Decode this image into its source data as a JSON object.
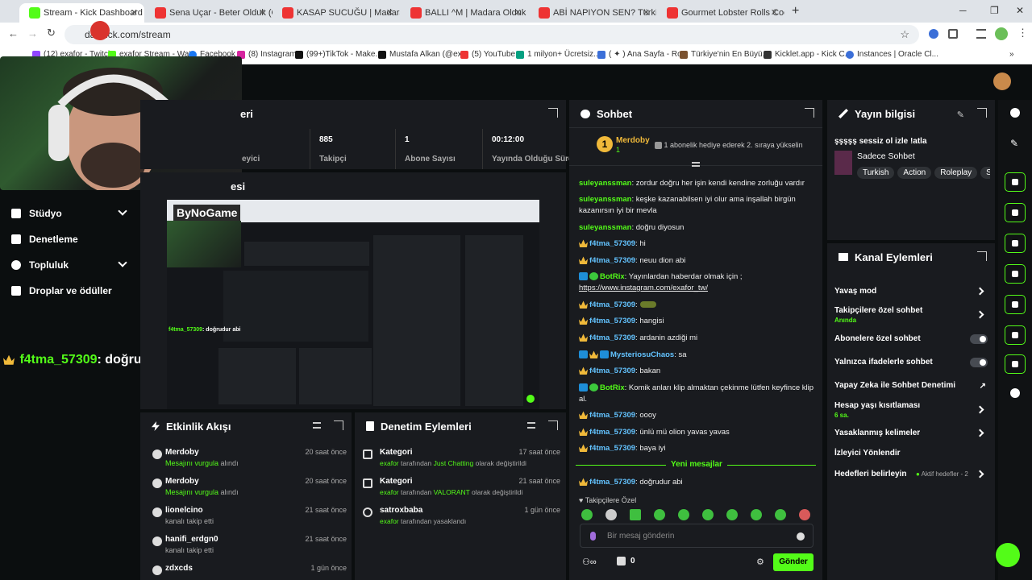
{
  "browser": {
    "tabs": [
      {
        "title": "Stream - Kick Dashboard",
        "color": "#53fc18",
        "active": true
      },
      {
        "title": "Sena Uçar - Beter Olduk (O",
        "color": "#e33"
      },
      {
        "title": "KASAP SUCUĞU | Madara Oldu",
        "color": "#e33"
      },
      {
        "title": "BALLI ^M | Madara Olduk #689",
        "color": "#e33"
      },
      {
        "title": "ABİ NAPIYON SEN? Türkiye'de",
        "color": "#e33"
      },
      {
        "title": "Gourmet Lobster Rolls Cooked",
        "color": "#e33"
      }
    ],
    "url": "dashboard.kick.com/stream",
    "url_visible": "da       .kick.com/stream",
    "bookmarks": [
      "(12) exafor - Twitch",
      "exafor Stream - Wat",
      "Facebook",
      "(8) Instagram",
      "(99+)TikTok - Make...",
      "Mustafa Alkan (@ex...",
      "(5) YouTube",
      "1 milyon+ Ücretsiz...",
      "( ✦ ) Ana Sayfa - Ro...",
      "Türkiye'nin En Büyü...",
      "Kicklet.app - Kick C...",
      "Instances | Oracle Cl..."
    ]
  },
  "sidebar": {
    "items": [
      {
        "label": "Stüdyo",
        "has_chevron": true
      },
      {
        "label": "Denetleme",
        "has_chevron": false
      },
      {
        "label": "Topluluk",
        "has_chevron": true
      },
      {
        "label": "Droplar ve ödüller",
        "has_chevron": false
      }
    ],
    "overlay_user": "f4tma_57309",
    "overlay_text": ": doğrudur abi"
  },
  "stats": {
    "title_fragment": "eri",
    "cells": [
      {
        "label_fragment": "eyici",
        "value": ""
      },
      {
        "value": "885",
        "label": "Takipçi"
      },
      {
        "value": "1",
        "label": "Abone Sayısı"
      },
      {
        "value": "00:12:00",
        "label": "Yayında Olduğu Süre"
      }
    ]
  },
  "preview": {
    "title_fragment": "esi",
    "logo": "ByNoGame"
  },
  "activity": {
    "title": "Etkinlik Akışı",
    "items": [
      {
        "name": "Merdoby",
        "time": "20 saat önce",
        "highlight": "Mesajını vurgula",
        "rest": " alındı"
      },
      {
        "name": "Merdoby",
        "time": "20 saat önce",
        "highlight": "Mesajını vurgula",
        "rest": " alındı"
      },
      {
        "name": "lionelcino",
        "time": "21 saat önce",
        "highlight": "",
        "rest": "kanalı takip etti"
      },
      {
        "name": "hanifi_erdgn0",
        "time": "21 saat önce",
        "highlight": "",
        "rest": "kanalı takip etti"
      },
      {
        "name": "zdxcds",
        "time": "1 gün önce",
        "highlight": "",
        "rest": ""
      }
    ]
  },
  "modlog": {
    "title": "Denetim Eylemleri",
    "items": [
      {
        "name": "Kategori",
        "time": "17 saat önce",
        "who": "exafor",
        "mid": " tarafından ",
        "val": "Just Chatting",
        "end": " olarak değiştirildi"
      },
      {
        "name": "Kategori",
        "time": "21 saat önce",
        "who": "exafor",
        "mid": " tarafından ",
        "val": "VALORANT",
        "end": " olarak değiştirildi"
      },
      {
        "name": "satroxbaba",
        "time": "1 gün önce",
        "who": "exafor",
        "mid": " tarafından yasaklandı",
        "val": "",
        "end": ""
      }
    ]
  },
  "chat": {
    "title": "Sohbet",
    "pinned_user": "Merdoby",
    "pinned_rank": "1",
    "pinned_count": "1",
    "pinned_msg": "1 abonelik hediye ederek 2. sıraya yükselin",
    "messages": [
      {
        "user": "suleyanssman",
        "text": ": zordur doğru her işin kendi kendine zorluğu vardır",
        "badges": []
      },
      {
        "user": "suleyanssman",
        "text": ": keşke kazanabilsen iyi olur ama inşallah birgün",
        "badges": []
      },
      {
        "user": "",
        "text": "kazanırsın iyi bir mevla",
        "badges": []
      },
      {
        "user": "suleyanssman",
        "text": ": doğru diyosun",
        "badges": []
      },
      {
        "user": "f4tma_57309",
        "text": ": hi",
        "badges": [
          "crown"
        ]
      },
      {
        "user": "f4tma_57309",
        "text": ": neuu dion abi",
        "badges": [
          "crown"
        ]
      },
      {
        "user": "BotRix",
        "text": ": Yayınlardan haberdar olmak için ;",
        "badges": [
          "blue",
          "green"
        ]
      },
      {
        "user": "",
        "text": "https://www.instagram.com/exafor_tw/",
        "badges": []
      },
      {
        "user": "f4tma_57309",
        "text": ":",
        "badges": [
          "crown"
        ]
      },
      {
        "user": "f4tma_57309",
        "text": ": hangisi",
        "badges": [
          "crown"
        ]
      },
      {
        "user": "f4tma_57309",
        "text": ": ardanin azdiği mi",
        "badges": [
          "crown"
        ]
      },
      {
        "user": "MysteriosuChaos",
        "text": ": sa",
        "badges": [
          "blue",
          "crown",
          "blue"
        ]
      },
      {
        "user": "f4tma_57309",
        "text": ": bakan",
        "badges": [
          "crown"
        ]
      },
      {
        "user": "BotRix",
        "text": ": Komik anları klip almaktan çekinme lütfen keyfince klip",
        "badges": [
          "blue",
          "green"
        ]
      },
      {
        "user": "",
        "text": "al.",
        "badges": []
      },
      {
        "user": "f4tma_57309",
        "text": ": oooy",
        "badges": [
          "crown"
        ]
      },
      {
        "user": "f4tma_57309",
        "text": ": ünlü mü olion yavas yavas",
        "badges": [
          "crown"
        ]
      },
      {
        "user": "f4tma_57309",
        "text": ": baya iyi",
        "badges": [
          "crown"
        ]
      }
    ],
    "new_messages": "Yeni mesajlar",
    "last_user": "f4tma_57309",
    "last_text": ": doğrudur abi",
    "followers_only": "Takipçilere Özel",
    "input_placeholder": "Bir mesaj gönderin",
    "points": "0",
    "send": "Gönder"
  },
  "stream_info": {
    "title": "Yayın bilgisi",
    "stream_title": "şşşşş sessiz ol izle !atla",
    "category": "Sadece Sohbet",
    "tags": [
      "Turkish",
      "Action",
      "Roleplay",
      "Sh"
    ]
  },
  "channel_actions": {
    "title": "Kanal Eylemleri",
    "items": [
      {
        "label": "Yavaş mod",
        "sub": "",
        "control": "arrow"
      },
      {
        "label": "Takipçilere özel sohbet",
        "sub": "Anında",
        "control": "arrow"
      },
      {
        "label": "Abonelere özel sohbet",
        "sub": "",
        "control": "toggle"
      },
      {
        "label": "Yalnızca ifadelerle sohbet",
        "sub": "",
        "control": "toggle"
      },
      {
        "label": "Yapay Zeka ile Sohbet Denetimi",
        "sub": "",
        "control": "external"
      },
      {
        "label": "Hesap yaşı kısıtlaması",
        "sub": "6 sa.",
        "control": "arrow"
      },
      {
        "label": "Yasaklanmış kelimeler",
        "sub": "",
        "control": "arrow"
      },
      {
        "label": "İzleyici Yönlendir",
        "sub": "",
        "control": "none"
      },
      {
        "label": "Hedefleri belirleyin",
        "sub": "",
        "control": "arrow",
        "extra": "Aktif hedefler - 2"
      }
    ]
  },
  "colors": {
    "brand": "#53fc18",
    "panel": "#191b1f",
    "bg": "#0b0e0f"
  }
}
